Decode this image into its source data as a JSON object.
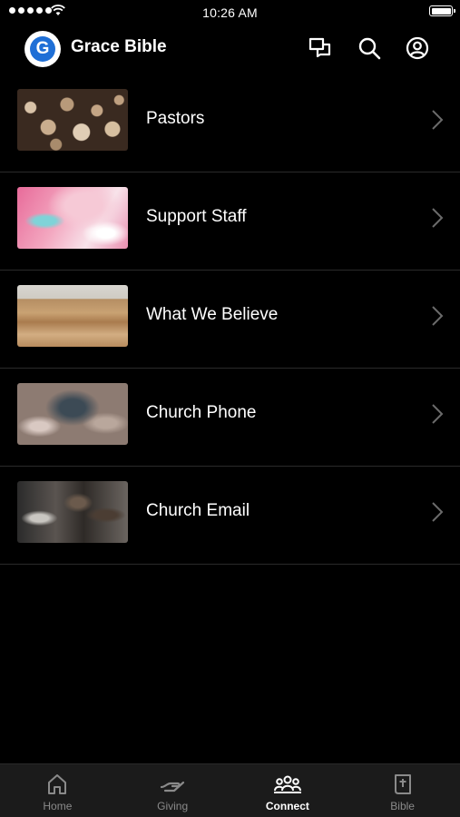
{
  "status_bar": {
    "time": "10:26 AM"
  },
  "header": {
    "title": "Grace Bible",
    "logo_letter": "G"
  },
  "list": [
    {
      "label": "Pastors",
      "thumb": "wood-logs"
    },
    {
      "label": "Support Staff",
      "thumb": "pink-marble"
    },
    {
      "label": "What We Believe",
      "thumb": "desert-dunes"
    },
    {
      "label": "Church Phone",
      "thumb": "textured-stone"
    },
    {
      "label": "Church Email",
      "thumb": "people-group"
    }
  ],
  "tabbar": {
    "tabs": [
      {
        "label": "Home",
        "icon": "home-icon",
        "active": false
      },
      {
        "label": "Giving",
        "icon": "giving-icon",
        "active": false
      },
      {
        "label": "Connect",
        "icon": "connect-icon",
        "active": true
      },
      {
        "label": "Bible",
        "icon": "bible-icon",
        "active": false
      }
    ]
  }
}
